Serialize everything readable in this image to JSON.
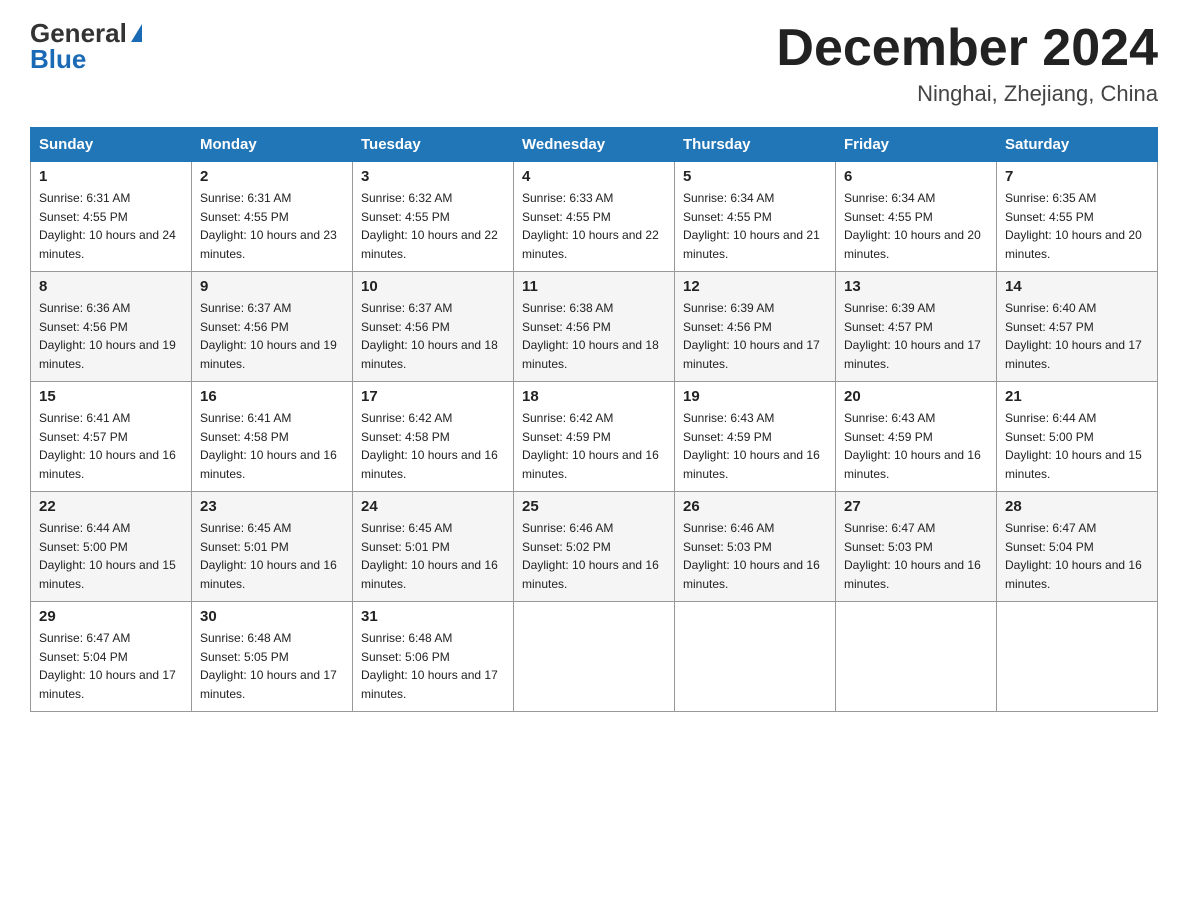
{
  "header": {
    "logo_general": "General",
    "logo_blue": "Blue",
    "month_title": "December 2024",
    "location": "Ninghai, Zhejiang, China"
  },
  "weekdays": [
    "Sunday",
    "Monday",
    "Tuesday",
    "Wednesday",
    "Thursday",
    "Friday",
    "Saturday"
  ],
  "weeks": [
    [
      {
        "day": "1",
        "sunrise": "6:31 AM",
        "sunset": "4:55 PM",
        "daylight": "10 hours and 24 minutes."
      },
      {
        "day": "2",
        "sunrise": "6:31 AM",
        "sunset": "4:55 PM",
        "daylight": "10 hours and 23 minutes."
      },
      {
        "day": "3",
        "sunrise": "6:32 AM",
        "sunset": "4:55 PM",
        "daylight": "10 hours and 22 minutes."
      },
      {
        "day": "4",
        "sunrise": "6:33 AM",
        "sunset": "4:55 PM",
        "daylight": "10 hours and 22 minutes."
      },
      {
        "day": "5",
        "sunrise": "6:34 AM",
        "sunset": "4:55 PM",
        "daylight": "10 hours and 21 minutes."
      },
      {
        "day": "6",
        "sunrise": "6:34 AM",
        "sunset": "4:55 PM",
        "daylight": "10 hours and 20 minutes."
      },
      {
        "day": "7",
        "sunrise": "6:35 AM",
        "sunset": "4:55 PM",
        "daylight": "10 hours and 20 minutes."
      }
    ],
    [
      {
        "day": "8",
        "sunrise": "6:36 AM",
        "sunset": "4:56 PM",
        "daylight": "10 hours and 19 minutes."
      },
      {
        "day": "9",
        "sunrise": "6:37 AM",
        "sunset": "4:56 PM",
        "daylight": "10 hours and 19 minutes."
      },
      {
        "day": "10",
        "sunrise": "6:37 AM",
        "sunset": "4:56 PM",
        "daylight": "10 hours and 18 minutes."
      },
      {
        "day": "11",
        "sunrise": "6:38 AM",
        "sunset": "4:56 PM",
        "daylight": "10 hours and 18 minutes."
      },
      {
        "day": "12",
        "sunrise": "6:39 AM",
        "sunset": "4:56 PM",
        "daylight": "10 hours and 17 minutes."
      },
      {
        "day": "13",
        "sunrise": "6:39 AM",
        "sunset": "4:57 PM",
        "daylight": "10 hours and 17 minutes."
      },
      {
        "day": "14",
        "sunrise": "6:40 AM",
        "sunset": "4:57 PM",
        "daylight": "10 hours and 17 minutes."
      }
    ],
    [
      {
        "day": "15",
        "sunrise": "6:41 AM",
        "sunset": "4:57 PM",
        "daylight": "10 hours and 16 minutes."
      },
      {
        "day": "16",
        "sunrise": "6:41 AM",
        "sunset": "4:58 PM",
        "daylight": "10 hours and 16 minutes."
      },
      {
        "day": "17",
        "sunrise": "6:42 AM",
        "sunset": "4:58 PM",
        "daylight": "10 hours and 16 minutes."
      },
      {
        "day": "18",
        "sunrise": "6:42 AM",
        "sunset": "4:59 PM",
        "daylight": "10 hours and 16 minutes."
      },
      {
        "day": "19",
        "sunrise": "6:43 AM",
        "sunset": "4:59 PM",
        "daylight": "10 hours and 16 minutes."
      },
      {
        "day": "20",
        "sunrise": "6:43 AM",
        "sunset": "4:59 PM",
        "daylight": "10 hours and 16 minutes."
      },
      {
        "day": "21",
        "sunrise": "6:44 AM",
        "sunset": "5:00 PM",
        "daylight": "10 hours and 15 minutes."
      }
    ],
    [
      {
        "day": "22",
        "sunrise": "6:44 AM",
        "sunset": "5:00 PM",
        "daylight": "10 hours and 15 minutes."
      },
      {
        "day": "23",
        "sunrise": "6:45 AM",
        "sunset": "5:01 PM",
        "daylight": "10 hours and 16 minutes."
      },
      {
        "day": "24",
        "sunrise": "6:45 AM",
        "sunset": "5:01 PM",
        "daylight": "10 hours and 16 minutes."
      },
      {
        "day": "25",
        "sunrise": "6:46 AM",
        "sunset": "5:02 PM",
        "daylight": "10 hours and 16 minutes."
      },
      {
        "day": "26",
        "sunrise": "6:46 AM",
        "sunset": "5:03 PM",
        "daylight": "10 hours and 16 minutes."
      },
      {
        "day": "27",
        "sunrise": "6:47 AM",
        "sunset": "5:03 PM",
        "daylight": "10 hours and 16 minutes."
      },
      {
        "day": "28",
        "sunrise": "6:47 AM",
        "sunset": "5:04 PM",
        "daylight": "10 hours and 16 minutes."
      }
    ],
    [
      {
        "day": "29",
        "sunrise": "6:47 AM",
        "sunset": "5:04 PM",
        "daylight": "10 hours and 17 minutes."
      },
      {
        "day": "30",
        "sunrise": "6:48 AM",
        "sunset": "5:05 PM",
        "daylight": "10 hours and 17 minutes."
      },
      {
        "day": "31",
        "sunrise": "6:48 AM",
        "sunset": "5:06 PM",
        "daylight": "10 hours and 17 minutes."
      },
      null,
      null,
      null,
      null
    ]
  ]
}
